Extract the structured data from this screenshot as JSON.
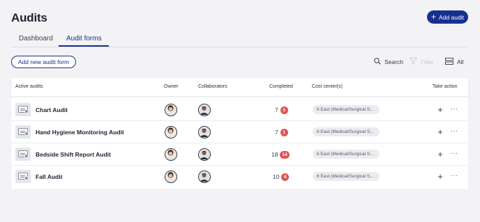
{
  "header": {
    "title": "Audits",
    "add_audit_label": "Add audit",
    "add_icon": "plus-icon"
  },
  "tabs": [
    {
      "label": "Dashboard",
      "active": false
    },
    {
      "label": "Audit forms",
      "active": true
    }
  ],
  "toolbar": {
    "add_form_label": "Add new audit form",
    "search_label": "Search",
    "search_icon": "search-icon",
    "filter_label": "Filter",
    "filter_icon": "filter-icon",
    "view_label": "All",
    "view_icon": "list-view-icon"
  },
  "table": {
    "columns": [
      "Active audits",
      "Owner",
      "Collaborators",
      "Completed",
      "Cost center(s)",
      "Take action"
    ],
    "rows": [
      {
        "name": "Chart Audit",
        "completed": "7",
        "badge": "3",
        "cost_center": "6 East (Medical/Surgical S..."
      },
      {
        "name": "Hand Hygiene Monitoring Audit",
        "completed": "7",
        "badge": "1",
        "cost_center": "6 East (Medical/Surgical S..."
      },
      {
        "name": "Bedside Shift Report Audit",
        "completed": "18",
        "badge": "14",
        "cost_center": "6 East (Medical/Surgical S..."
      },
      {
        "name": "Fall Audit",
        "completed": "10",
        "badge": "6",
        "cost_center": "6 East (Medical/Surgical S..."
      }
    ]
  },
  "colors": {
    "primary": "#17308f",
    "badge": "#e05454",
    "background": "#f3f3f5"
  }
}
